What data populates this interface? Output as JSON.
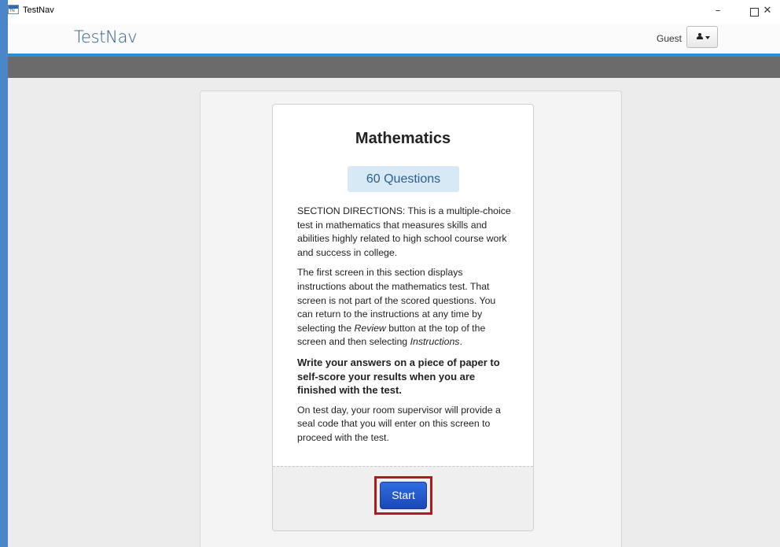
{
  "window": {
    "title": "TestNav",
    "icon_text": "TN",
    "controls": {
      "minimize": "–",
      "close": "✕"
    }
  },
  "header": {
    "brand": "TestNav",
    "user_label": "Guest",
    "user_menu_icon": "user-icon"
  },
  "colors": {
    "accent_rule": "#2a8fd6",
    "band": "#6b6b6b",
    "start_button": "#2f6de0",
    "highlight": "#b11a1a"
  },
  "section": {
    "title": "Mathematics",
    "question_count": "60 Questions",
    "directions": "SECTION DIRECTIONS: This is a multiple-choice test in mathematics that measures skills and abilities highly related to high school course work and success in college.",
    "instructions_p1": "The first screen in this section displays instructions about the mathematics test. That screen is not part of the scored questions. You can return to the instructions at any time by selecting the ",
    "review_word": "Review",
    "instructions_p2": " button at the top of the screen and then selecting ",
    "instructions_word": "Instructions",
    "instructions_end": ".",
    "bold_note": "Write your answers on a piece of paper to self-score your results when you are finished with the test.",
    "seal_note": "On test day, your room supervisor will provide a seal code that you will enter on this screen to proceed with the test.",
    "start_label": "Start"
  }
}
